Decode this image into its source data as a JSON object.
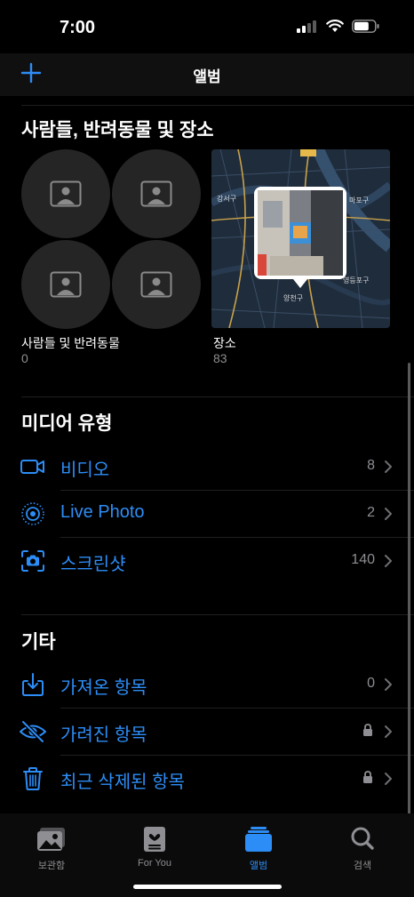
{
  "status_bar": {
    "time": "7:00"
  },
  "nav": {
    "title": "앨범",
    "add_icon": "plus-icon"
  },
  "people_places": {
    "title": "사람들, 반려동물 및 장소",
    "people": {
      "label": "사람들 및 반려동물",
      "count": "0"
    },
    "places": {
      "label": "장소",
      "count": "83"
    },
    "map_labels": {
      "top": "강서구",
      "right": "마포구",
      "bottom": "양천구",
      "right2": "영등포구"
    }
  },
  "media_types": {
    "title": "미디어 유형",
    "items": [
      {
        "label": "비디오",
        "count": "8",
        "icon": "video-icon"
      },
      {
        "label": "Live Photo",
        "count": "2",
        "icon": "live-photo-icon"
      },
      {
        "label": "스크린샷",
        "count": "140",
        "icon": "screenshot-icon"
      }
    ]
  },
  "other": {
    "title": "기타",
    "items": [
      {
        "label": "가져온 항목",
        "count": "0",
        "icon": "import-icon"
      },
      {
        "label": "가려진 항목",
        "icon": "hidden-eye-icon",
        "locked": true
      },
      {
        "label": "최근 삭제된 항목",
        "icon": "trash-icon",
        "locked": true
      }
    ]
  },
  "tabs": [
    {
      "label": "보관함",
      "icon": "library-icon"
    },
    {
      "label": "For You",
      "icon": "for-you-icon"
    },
    {
      "label": "앨범",
      "icon": "albums-icon",
      "active": true
    },
    {
      "label": "검색",
      "icon": "search-icon"
    }
  ],
  "colors": {
    "accent": "#2d8df6",
    "secondary": "#8e8e93",
    "background": "#000000"
  }
}
